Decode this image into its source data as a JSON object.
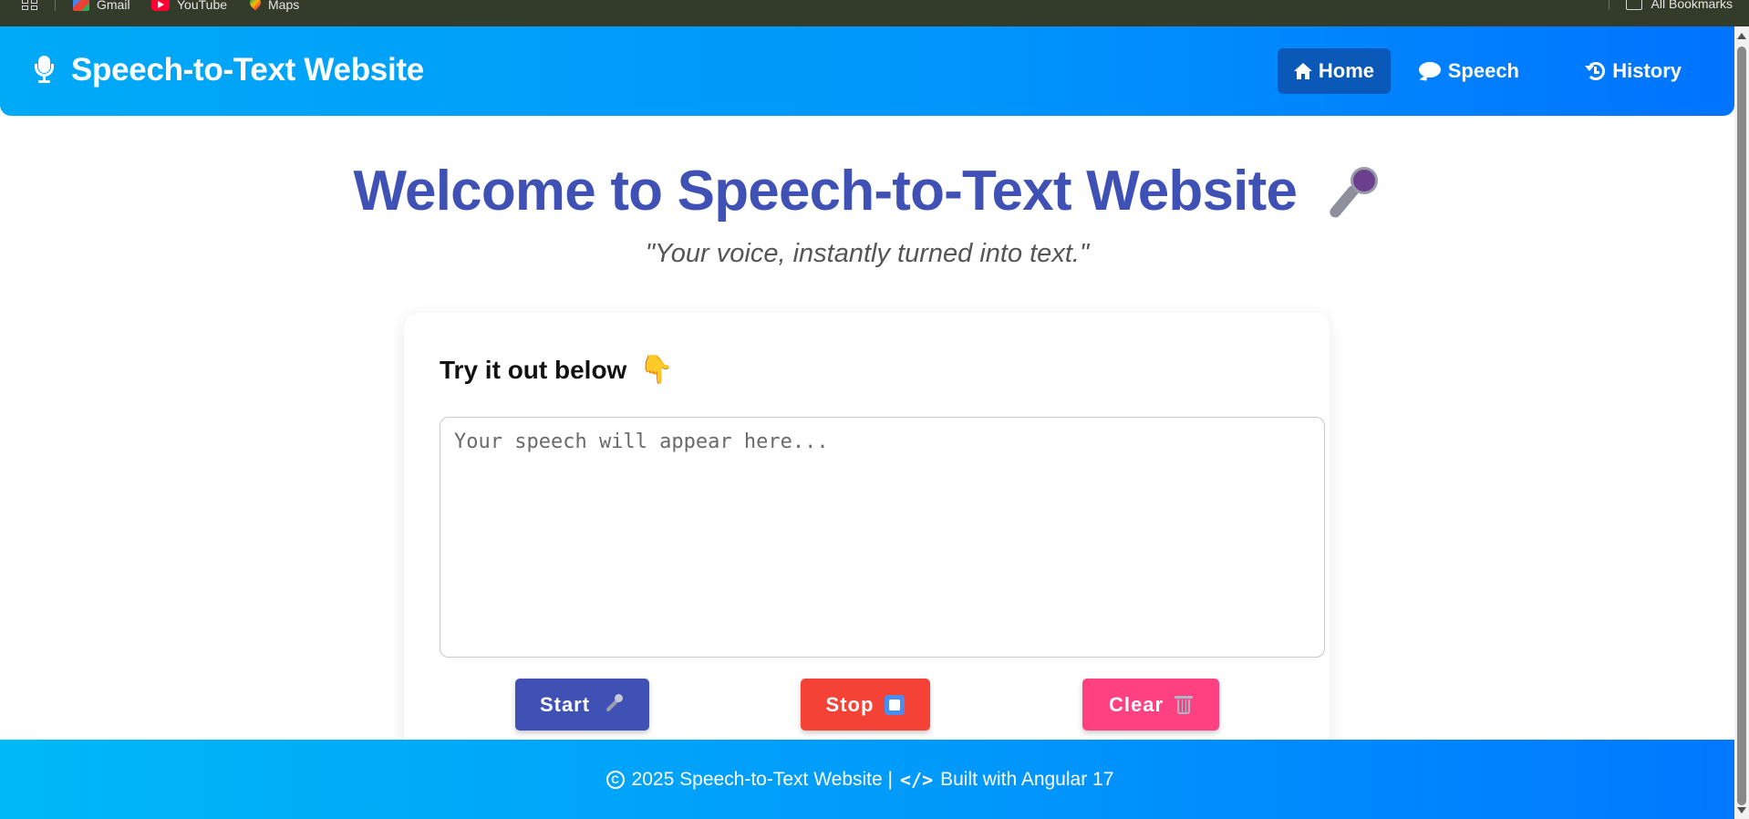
{
  "bookmarks": {
    "items": [
      {
        "label": "Gmail",
        "icon": "gmail-icon"
      },
      {
        "label": "YouTube",
        "icon": "youtube-icon"
      },
      {
        "label": "Maps",
        "icon": "maps-icon"
      }
    ],
    "all_bookmarks": "All Bookmarks"
  },
  "header": {
    "title": "Speech-to-Text Website",
    "nav": [
      {
        "label": "Home",
        "icon": "home-icon",
        "active": true
      },
      {
        "label": "Speech",
        "icon": "comment-icon",
        "active": false
      },
      {
        "label": "History",
        "icon": "history-icon",
        "active": false
      }
    ]
  },
  "hero": {
    "title": "Welcome to Speech-to-Text Website",
    "subtitle": "\"Your voice, instantly turned into text.\""
  },
  "card": {
    "title": "Try it out below",
    "textarea_value": "",
    "textarea_placeholder": "Your speech will appear here...",
    "buttons": {
      "start": "Start",
      "stop": "Stop",
      "clear": "Clear"
    }
  },
  "footer": {
    "year_text": "2025 Speech-to-Text Website |",
    "built_with": "Built with Angular 17"
  },
  "colors": {
    "header_gradient_start": "#00aaf7",
    "header_gradient_end": "#0073ff",
    "active_nav": "#0a58b8",
    "hero_title": "#3f51b5",
    "start_button": "#3f51b5",
    "stop_button": "#f44336",
    "clear_button": "#ff4081"
  }
}
